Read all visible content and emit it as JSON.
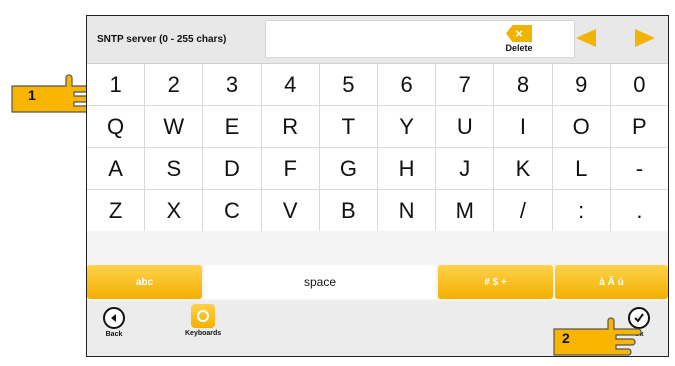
{
  "header": {
    "field_label": "SNTP server (0 - 255 chars)",
    "field_value": "",
    "delete_label": "Delete",
    "delete_icon": "delete-x-icon",
    "nav_left_icon": "arrow-left-icon",
    "nav_right_icon": "arrow-right-icon"
  },
  "keys": [
    [
      "1",
      "2",
      "3",
      "4",
      "5",
      "6",
      "7",
      "8",
      "9",
      "0"
    ],
    [
      "Q",
      "W",
      "E",
      "R",
      "T",
      "Y",
      "U",
      "I",
      "O",
      "P"
    ],
    [
      "A",
      "S",
      "D",
      "F",
      "G",
      "H",
      "J",
      "K",
      "L",
      "-"
    ],
    [
      "Z",
      "X",
      "C",
      "V",
      "B",
      "N",
      "M",
      "/",
      ":",
      "."
    ]
  ],
  "function_row": {
    "abc": "abc",
    "space": "space",
    "symbols": "# $ +",
    "accents": "à Ã ú"
  },
  "bottom": {
    "back_label": "Back",
    "keyboards_label": "Keyboards",
    "ok_label": "Ok"
  },
  "callouts": {
    "one": "1",
    "two": "2"
  },
  "colors": {
    "accent": "#f2b400",
    "border": "#222222"
  }
}
